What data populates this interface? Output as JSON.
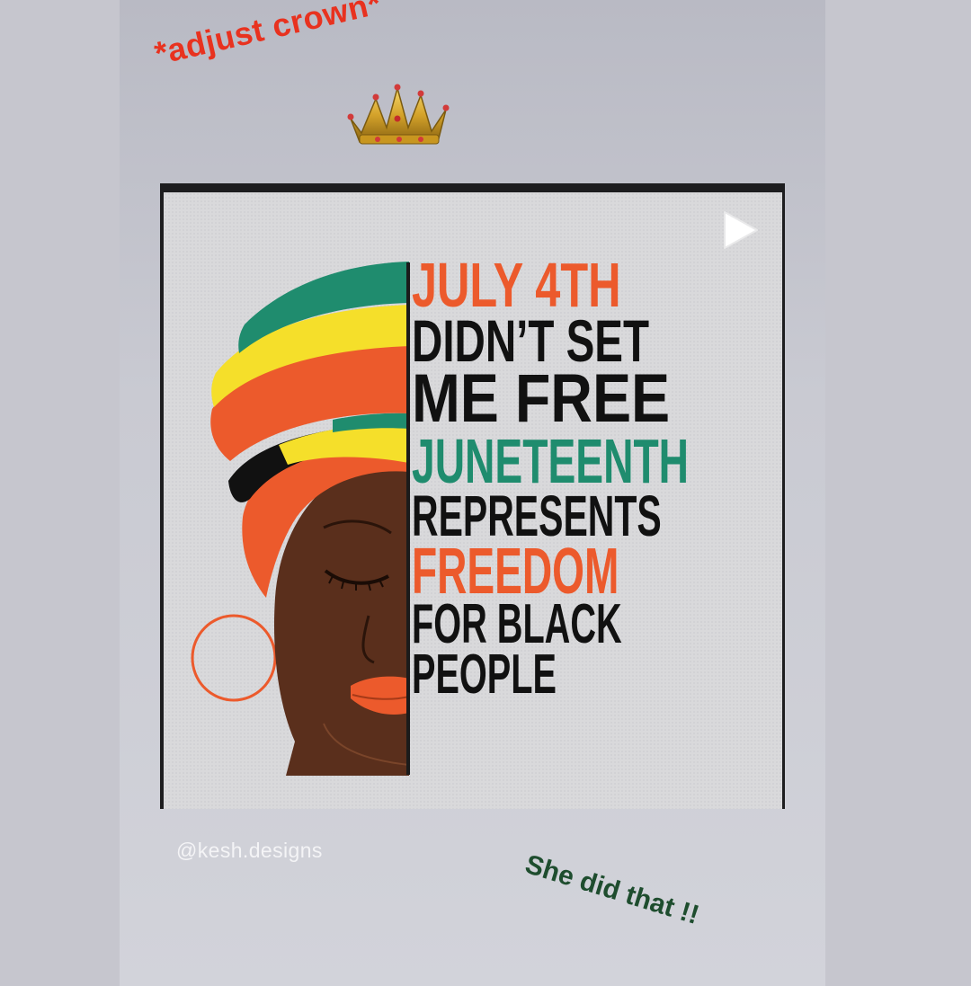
{
  "story": {
    "sticker_top": "*adjust crown*",
    "sticker_bottom": "She did that !!",
    "credit": "@kesh.designs"
  },
  "shirt": {
    "lines": [
      "JULY 4TH",
      "DIDN’T SET",
      "ME FREE",
      "JUNETEENTH",
      "REPRESENTS",
      "FREEDOM",
      "FOR BLACK",
      "PEOPLE"
    ]
  },
  "icons": {
    "crown": "crown-icon",
    "play": "play-icon"
  },
  "colors": {
    "accent_red": "#e8321f",
    "shirt_orange": "#ec5a2c",
    "shirt_green": "#1f8c6e",
    "shirt_yellow": "#f5df2a",
    "sticker_green": "#1e4d2e"
  }
}
